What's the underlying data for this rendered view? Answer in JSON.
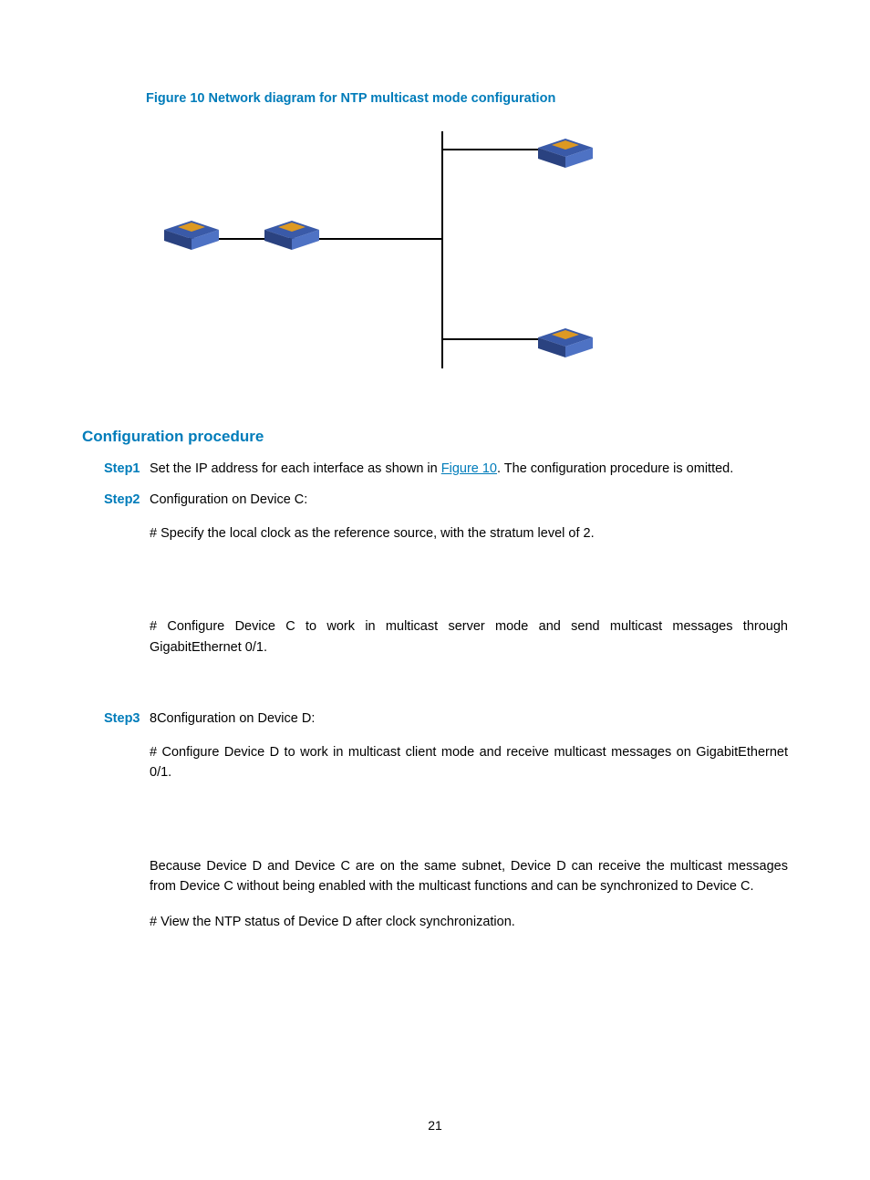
{
  "figure_title": "Figure 10 Network diagram for NTP multicast mode configuration",
  "section_title": "Configuration procedure",
  "steps": {
    "s1_label": "Step1",
    "s1_text_a": "Set the IP address for each interface as shown in ",
    "s1_link": "Figure 10",
    "s1_text_b": ". The configuration procedure is omitted.",
    "s2_label": "Step2",
    "s2_text": "Configuration on Device C:",
    "s2_p1": "# Specify the local clock as the reference source, with the stratum level of 2.",
    "s2_p2": "# Configure Device C to work in multicast server mode and send multicast messages through GigabitEthernet 0/1.",
    "s3_label": "Step3",
    "s3_text": "8Configuration on Device D:",
    "s3_p1": "# Configure Device D to work in multicast client mode and receive multicast messages on GigabitEthernet 0/1.",
    "s3_p2": "Because Device D and Device C are on the same subnet, Device D can receive the multicast messages from Device C without being enabled with the multicast functions and can be synchronized to Device C.",
    "s3_p3": "# View the NTP status of Device D after clock synchronization."
  },
  "page_number": "21"
}
